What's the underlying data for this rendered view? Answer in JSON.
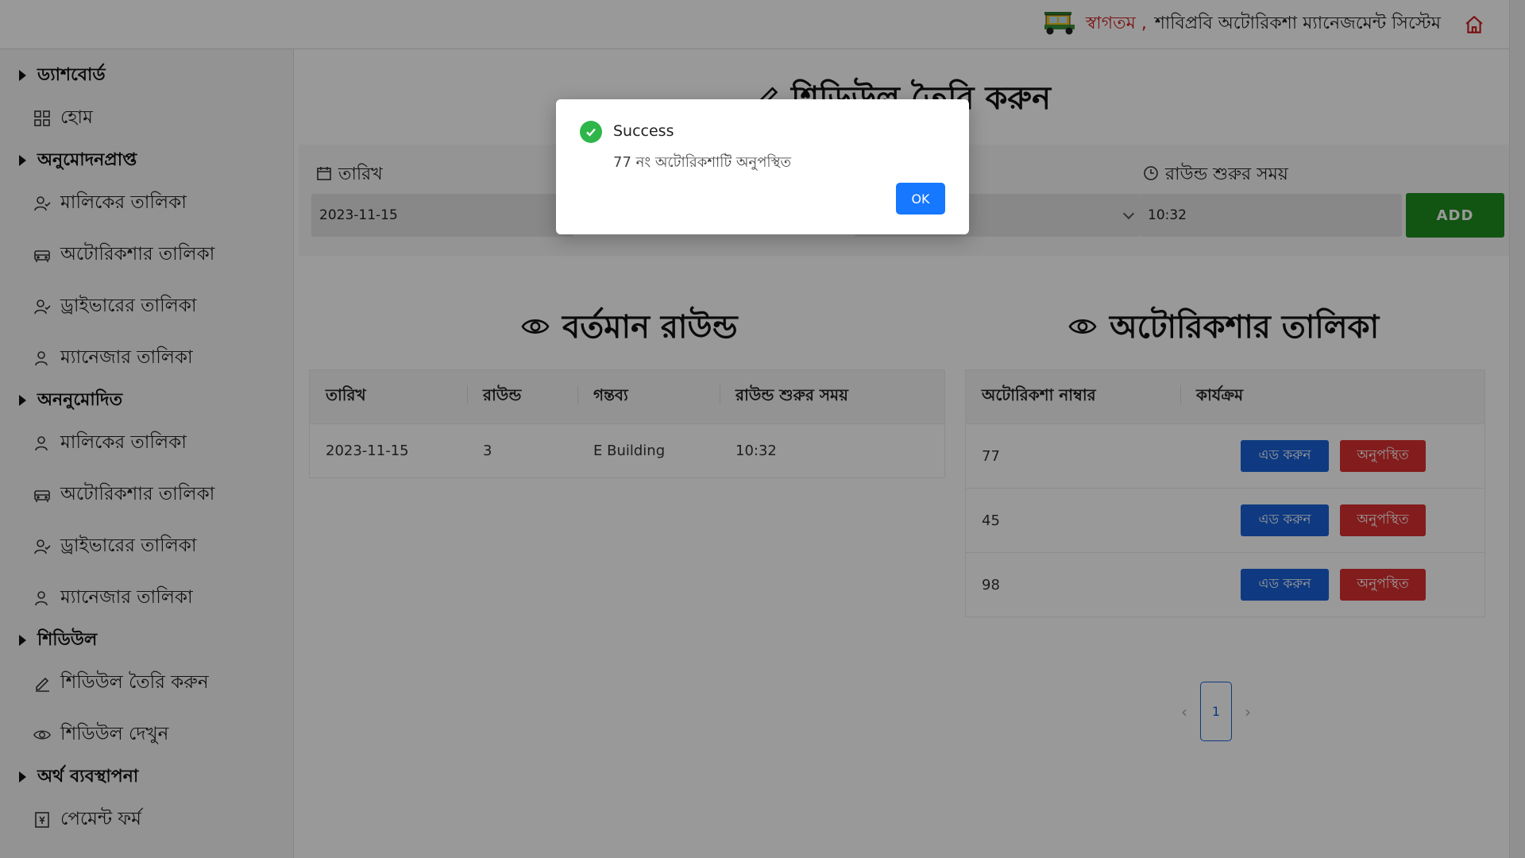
{
  "header": {
    "welcome": "স্বাগতম ,",
    "system_title": "শাবিপ্রবি অটোরিকশা ম্যানেজমেন্ট সিস্টেম"
  },
  "sidebar": {
    "sections": [
      {
        "title": "ড্যাশবোর্ড",
        "items": [
          {
            "label": "হোম",
            "icon": "grid-icon"
          }
        ]
      },
      {
        "title": "অনুমোদনপ্রাপ্ত",
        "items": [
          {
            "label": "মালিকের তালিকা",
            "icon": "user-check-icon"
          },
          {
            "label": "অটোরিকশার তালিকা",
            "icon": "car-icon"
          },
          {
            "label": "ড্রাইভারের তালিকা",
            "icon": "user-check-icon"
          },
          {
            "label": "ম্যানেজার তালিকা",
            "icon": "user-icon"
          }
        ]
      },
      {
        "title": "অননুমোদিত",
        "items": [
          {
            "label": "মালিকের তালিকা",
            "icon": "user-icon"
          },
          {
            "label": "অটোরিকশার তালিকা",
            "icon": "car-icon"
          },
          {
            "label": "ড্রাইভারের তালিকা",
            "icon": "user-check-icon"
          },
          {
            "label": "ম্যানেজার তালিকা",
            "icon": "user-icon"
          }
        ]
      },
      {
        "title": "শিডিউল",
        "items": [
          {
            "label": "শিডিউল তৈরি করুন",
            "icon": "pencil-icon"
          },
          {
            "label": "শিডিউল দেখুন",
            "icon": "eye-icon"
          }
        ]
      },
      {
        "title": "অর্থ ব্যবস্থাপনা",
        "items": [
          {
            "label": "পেমেন্ট ফর্ম",
            "icon": "money-icon"
          }
        ]
      }
    ]
  },
  "main": {
    "page_title": "শিডিউল তৈরি করুন",
    "form": {
      "date_label": "তারিখ",
      "date_value": "2023-11-15",
      "start_time_label": "রাউন্ড শুরুর সময়",
      "start_time_value": "10:32",
      "add_label": "ADD"
    },
    "current_round": {
      "heading": "বর্তমান রাউন্ড",
      "columns": [
        "তারিখ",
        "রাউন্ড",
        "গন্তব্য",
        "রাউন্ড শুরুর সময়"
      ],
      "rows": [
        [
          "2023-11-15",
          "3",
          "E Building",
          "10:32"
        ]
      ]
    },
    "auto_list": {
      "heading": "অটোরিকশার তালিকা",
      "columns": [
        "অটোরিকশা নাম্বার",
        "কার্যক্রম"
      ],
      "rows": [
        {
          "number": "77",
          "add_label": "এড করুন",
          "absent_label": "অনুপস্থিত"
        },
        {
          "number": "45",
          "add_label": "এড করুন",
          "absent_label": "অনুপস্থিত"
        },
        {
          "number": "98",
          "add_label": "এড করুন",
          "absent_label": "অনুপস্থিত"
        }
      ]
    },
    "pagination": {
      "current": "1",
      "prev": "‹",
      "next": "›"
    }
  },
  "modal": {
    "title": "Success",
    "message": "77 নং অটোরিকশাটি অনুপস্থিত",
    "ok_label": "OK"
  },
  "colors": {
    "accent_blue": "#1677ff",
    "success_green": "#2fb64a",
    "add_green": "#1f8c1f",
    "danger_red": "#db2f2f",
    "welcome_red": "#cc1f1f"
  }
}
